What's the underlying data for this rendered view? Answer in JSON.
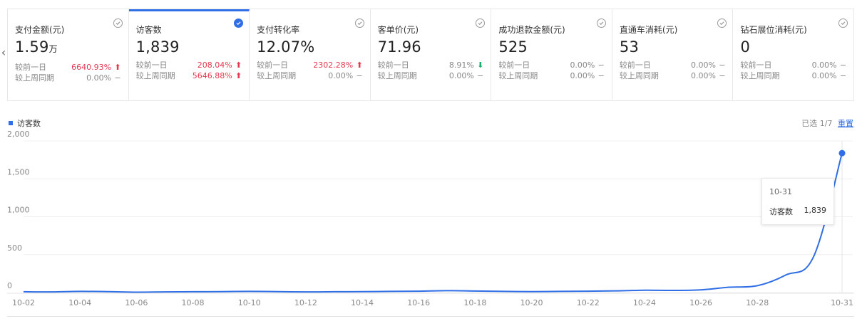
{
  "nav": {
    "left_arrow": "‹"
  },
  "cards": [
    {
      "label": "支付金额(元)",
      "value": "1.59",
      "unit": "万",
      "selected": false,
      "cmp": [
        {
          "label": "较前一日",
          "pct": "6640.93%",
          "dir": "up"
        },
        {
          "label": "较上周同期",
          "pct": "0.00%",
          "dir": "flat"
        }
      ]
    },
    {
      "label": "访客数",
      "value": "1,839",
      "unit": "",
      "selected": true,
      "cmp": [
        {
          "label": "较前一日",
          "pct": "208.04%",
          "dir": "up"
        },
        {
          "label": "较上周同期",
          "pct": "5646.88%",
          "dir": "up"
        }
      ]
    },
    {
      "label": "支付转化率",
      "value": "12.07%",
      "unit": "",
      "selected": false,
      "cmp": [
        {
          "label": "较前一日",
          "pct": "2302.28%",
          "dir": "up"
        },
        {
          "label": "较上周同期",
          "pct": "0.00%",
          "dir": "flat"
        }
      ]
    },
    {
      "label": "客单价(元)",
      "value": "71.96",
      "unit": "",
      "selected": false,
      "cmp": [
        {
          "label": "较前一日",
          "pct": "8.91%",
          "dir": "down"
        },
        {
          "label": "较上周同期",
          "pct": "0.00%",
          "dir": "flat"
        }
      ]
    },
    {
      "label": "成功退款金额(元)",
      "value": "525",
      "unit": "",
      "selected": false,
      "cmp": [
        {
          "label": "较前一日",
          "pct": "0.00%",
          "dir": "flat"
        },
        {
          "label": "较上周同期",
          "pct": "0.00%",
          "dir": "flat"
        }
      ]
    },
    {
      "label": "直通车消耗(元)",
      "value": "53",
      "unit": "",
      "selected": false,
      "cmp": [
        {
          "label": "较前一日",
          "pct": "0.00%",
          "dir": "flat"
        },
        {
          "label": "较上周同期",
          "pct": "0.00%",
          "dir": "flat"
        }
      ]
    },
    {
      "label": "钻石展位消耗(元)",
      "value": "0",
      "unit": "",
      "selected": false,
      "cmp": [
        {
          "label": "较前一日",
          "pct": "0.00%",
          "dir": "flat"
        },
        {
          "label": "较上周同期",
          "pct": "0.00%",
          "dir": "flat"
        }
      ]
    }
  ],
  "arrows": {
    "up": "⬆",
    "down": "⬇",
    "flat": "−"
  },
  "legend": {
    "series_name": "访客数"
  },
  "selection": {
    "text": "已选 1/7",
    "reset": "重置"
  },
  "tooltip": {
    "date": "10-31",
    "series": "访客数",
    "value": "1,839"
  },
  "colors": {
    "accent": "#2f6ee5",
    "up": "#e5384f",
    "down": "#1aad6b"
  },
  "chart_data": {
    "type": "line",
    "series": [
      {
        "name": "访客数",
        "x": [
          "10-02",
          "10-03",
          "10-04",
          "10-05",
          "10-06",
          "10-07",
          "10-08",
          "10-09",
          "10-10",
          "10-11",
          "10-12",
          "10-13",
          "10-14",
          "10-15",
          "10-16",
          "10-17",
          "10-18",
          "10-19",
          "10-20",
          "10-21",
          "10-22",
          "10-23",
          "10-24",
          "10-25",
          "10-26",
          "10-27",
          "10-28",
          "10-29",
          "10-30",
          "10-31"
        ],
        "values": [
          10,
          8,
          15,
          12,
          5,
          8,
          10,
          12,
          15,
          12,
          8,
          10,
          12,
          15,
          18,
          25,
          20,
          15,
          12,
          15,
          18,
          22,
          30,
          28,
          35,
          70,
          90,
          230,
          480,
          1839
        ]
      }
    ],
    "x_tick_labels": [
      "10-02",
      "10-04",
      "10-06",
      "10-08",
      "10-10",
      "10-12",
      "10-14",
      "10-16",
      "10-18",
      "10-20",
      "10-22",
      "10-24",
      "10-26",
      "10-28",
      "10-31"
    ],
    "y_ticks": [
      0,
      500,
      1000,
      1500,
      2000
    ],
    "y_tick_labels": [
      "0",
      "500",
      "1,000",
      "1,500",
      "2,000"
    ],
    "ylim": [
      0,
      2000
    ],
    "grid": true,
    "legend": "top-left"
  }
}
